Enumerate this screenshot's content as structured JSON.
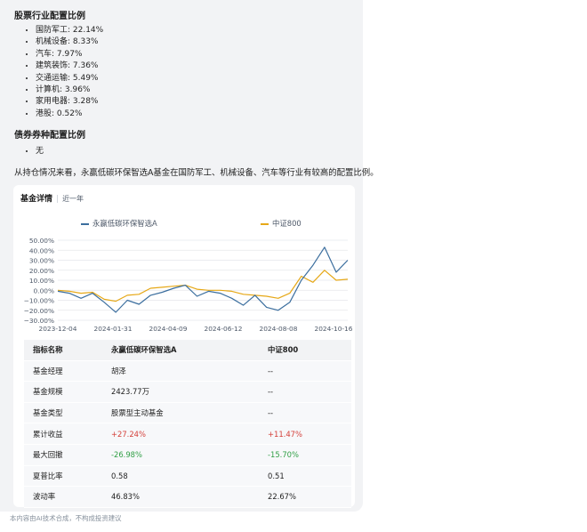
{
  "stock_section": {
    "title": "股票行业配置比例",
    "items": [
      "国防军工: 22.14%",
      "机械设备: 8.33%",
      "汽车: 7.97%",
      "建筑装饰: 7.36%",
      "交通运输: 5.49%",
      "计算机: 3.96%",
      "家用电器: 3.28%",
      "港股: 0.52%"
    ]
  },
  "bond_section": {
    "title": "债券券种配置比例",
    "items": [
      "无"
    ]
  },
  "summary": "从持仓情况来看，永赢低碳环保智选A基金在国防军工、机械设备、汽车等行业有较高的配置比例。",
  "card": {
    "title": "基金详情",
    "period": "近一年"
  },
  "chart_data": {
    "type": "line",
    "x_ticks": [
      "2023-12-04",
      "2024-01-31",
      "2024-04-09",
      "2024-06-12",
      "2024-08-08",
      "2024-10-16"
    ],
    "y_ticks": [
      "50.00%",
      "40.00%",
      "30.00%",
      "20.00%",
      "10.00%",
      "0.00%",
      "−10.00%",
      "−20.00%",
      "−30.00%"
    ],
    "ylim": [
      -30,
      50
    ],
    "grid": true,
    "legend_position": "top",
    "x": [
      0,
      4,
      8,
      12,
      16,
      20,
      24,
      28,
      32,
      36,
      40,
      44,
      48,
      52,
      56,
      60,
      64,
      68,
      72,
      76,
      80,
      84,
      88,
      92,
      96,
      100
    ],
    "series": [
      {
        "name": "永赢低碳环保智选A",
        "color": "#3b6e9e",
        "values": [
          -1,
          -3,
          -8,
          -3,
          -12,
          -22,
          -10,
          -14,
          -5,
          -2,
          2,
          5,
          -6,
          -1,
          -3,
          -8,
          -15,
          -5,
          -17,
          -20,
          -12,
          10,
          25,
          43,
          18,
          30
        ]
      },
      {
        "name": "中证800",
        "color": "#e6a817",
        "values": [
          0,
          -1,
          -3,
          -2,
          -9,
          -11,
          -5,
          -4,
          2,
          3,
          4,
          5,
          1,
          0,
          0,
          -1,
          -4,
          -5,
          -6,
          -8,
          -3,
          14,
          8,
          20,
          10,
          11
        ]
      }
    ]
  },
  "table": {
    "headers": [
      "指标名称",
      "永赢低碳环保智选A",
      "中证800"
    ],
    "rows": [
      [
        "基金经理",
        "胡泽",
        "--"
      ],
      [
        "基金规模",
        "2423.77万",
        "--"
      ],
      [
        "基金类型",
        "股票型主动基金",
        "--"
      ],
      [
        "累计收益",
        "+27.24%",
        "+11.47%"
      ],
      [
        "最大回撤",
        "-26.98%",
        "-15.70%"
      ],
      [
        "夏普比率",
        "0.58",
        "0.51"
      ],
      [
        "波动率",
        "46.83%",
        "22.67%"
      ]
    ]
  },
  "footer": "本内容由AI技术合成，不构成投资建议"
}
